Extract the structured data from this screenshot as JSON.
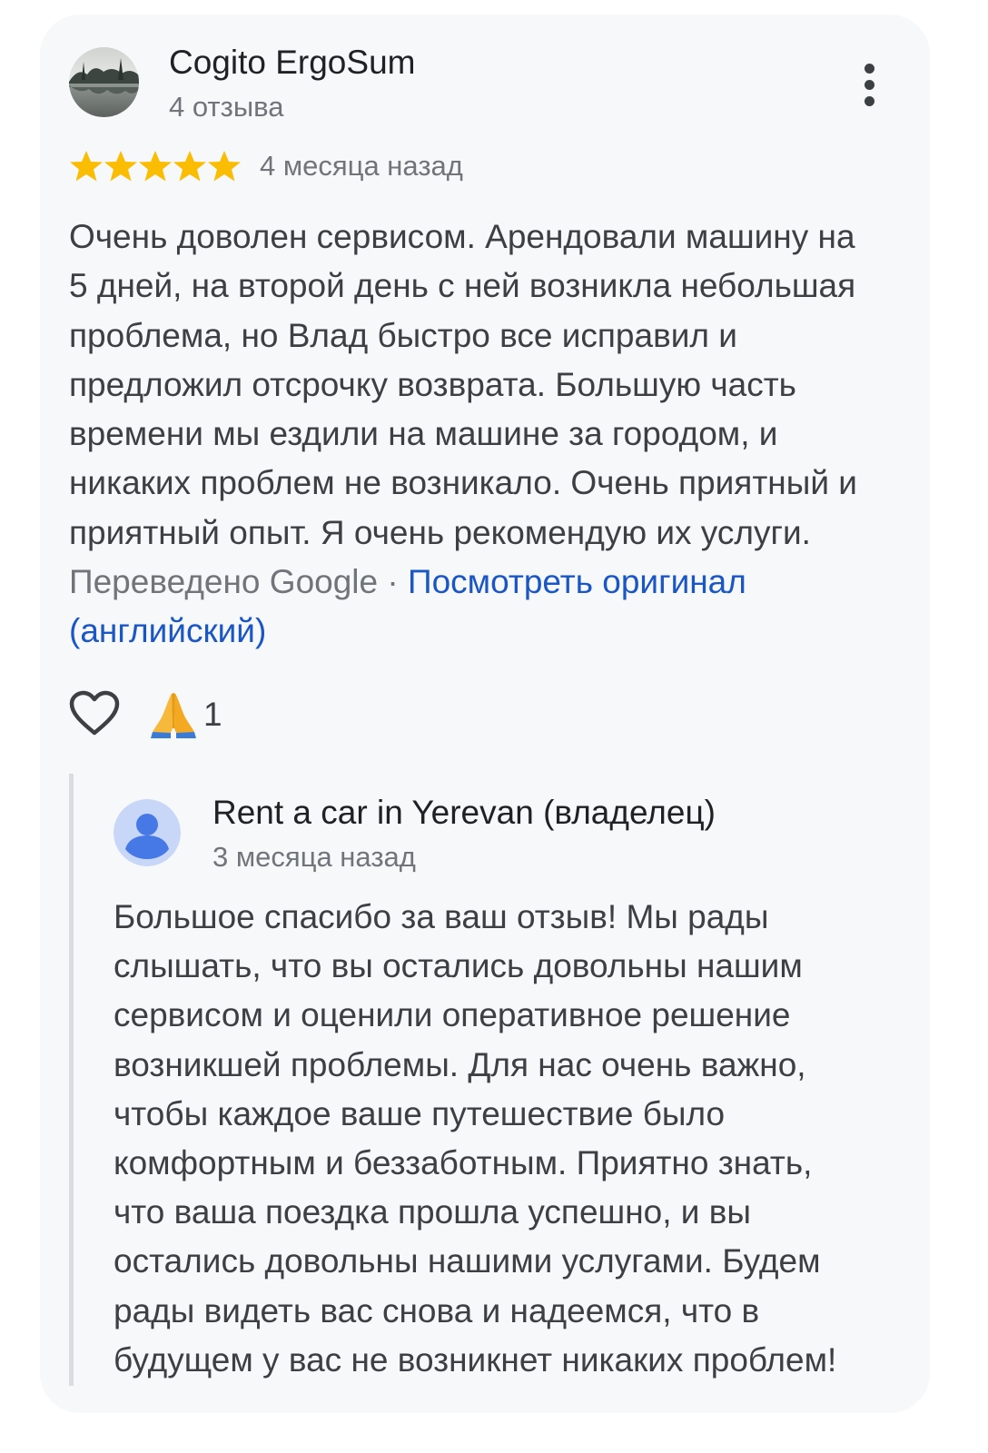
{
  "review": {
    "author": {
      "name": "Cogito ErgoSum",
      "reviews_count": "4 отзыва",
      "avatar": "landscape-photo"
    },
    "rating": 5,
    "date": "4 месяца назад",
    "text_lines": [
      "Очень доволен сервисом. Арендовали машину на",
      "5 дней, на второй день с ней возникла небольшая",
      "проблема, но Влад быстро все исправил и",
      "предложил отсрочку возврата. Большую часть",
      "времени мы ездили на машине за городом, и",
      "никаких проблем не возникало. Очень приятный и",
      "приятный опыт. Я очень рекомендую их услуги."
    ],
    "translated_by": "Переведено Google",
    "separator": " · ",
    "view_original_line1": "Посмотреть оригинал",
    "view_original_line2": "(английский)",
    "actions": {
      "like_icon": "heart-outline-icon",
      "reaction_icon": "folded-hands-emoji",
      "reaction_count": "1"
    }
  },
  "owner_reply": {
    "name": "Rent a car in Yerevan (владелец)",
    "date": "3 месяца назад",
    "avatar": "default-person-icon",
    "text_lines": [
      "Большое спасибо за ваш отзыв! Мы рады",
      "слышать, что вы остались довольны нашим",
      "сервисом и оценили оперативное решение",
      "возникшей проблемы. Для нас очень важно,",
      "чтобы каждое ваше путешествие было",
      "комфортным и беззаботным. Приятно знать,",
      "что ваша поездка прошла успешно, и вы",
      "остались довольны нашими услугами. Будем",
      "рады видеть вас снова и надеемся, что в",
      "будущем у вас не возникнет никаких проблем!"
    ]
  },
  "colors": {
    "card_background": "#f7f8fa",
    "star": "#fbbc04",
    "link": "#1a56c6",
    "primary_text": "#202124",
    "body_text": "#3c4043",
    "secondary_text": "#70757a",
    "reply_bar": "#dadce0",
    "owner_avatar_bg": "#c8d7f7",
    "owner_avatar_fg": "#4779e6"
  }
}
